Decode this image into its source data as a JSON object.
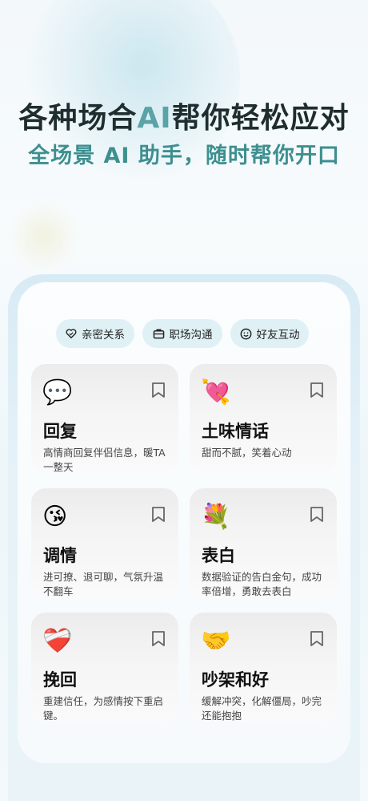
{
  "hero": {
    "headline_pre": "各种场合",
    "headline_ai": "AI",
    "headline_post": "帮你轻松应对",
    "subline": "全场景 AI 助手，随时帮你开口"
  },
  "tabs": [
    {
      "label": "亲密关系",
      "icon": "heart-outline-icon"
    },
    {
      "label": "职场沟通",
      "icon": "briefcase-icon"
    },
    {
      "label": "好友互动",
      "icon": "smile-icon"
    }
  ],
  "cards": [
    {
      "emoji": "💬",
      "title": "回复",
      "desc": "高情商回复伴侣信息，暖TA一整天"
    },
    {
      "emoji": "💘",
      "title": "土味情话",
      "desc": "甜而不腻，笑着心动"
    },
    {
      "emoji": "😘",
      "title": "调情",
      "desc": "进可撩、退可聊，气氛升温不翻车"
    },
    {
      "emoji": "💐",
      "title": "表白",
      "desc": "数据验证的告白金句，成功率倍增，勇敢去表白"
    },
    {
      "emoji": "❤️‍🩹",
      "title": "挽回",
      "desc": "重建信任，为感情按下重启键。"
    },
    {
      "emoji": "🤝",
      "title": "吵架和好",
      "desc": "缓解冲突，化解僵局，吵完还能抱抱"
    }
  ],
  "colors": {
    "headline": "#1f2d2e",
    "accent": "#3d8f90",
    "tab_bg": "#e0f1f5"
  }
}
